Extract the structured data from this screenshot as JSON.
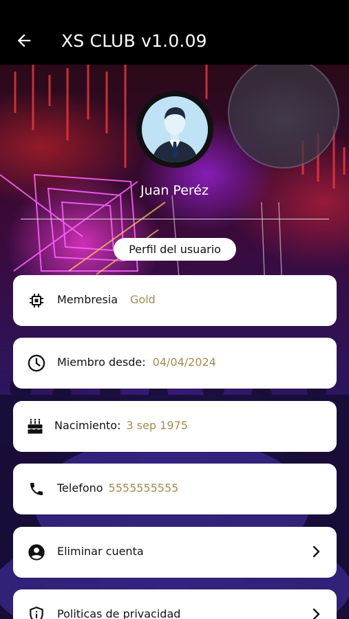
{
  "appbar": {
    "title": "XS CLUB v1.0.09",
    "back_icon": "arrow-back-icon"
  },
  "profile": {
    "name": "Juan Peréz",
    "avatar_icon": "user-avatar-icon"
  },
  "section": {
    "title": "Perfil del usuario"
  },
  "items": [
    {
      "icon": "chip-icon",
      "label": "Membresia",
      "value": "Gold"
    },
    {
      "icon": "clock-icon",
      "label": "Miembro desde:",
      "value": "04/04/2024"
    },
    {
      "icon": "cake-icon",
      "label": "Nacimiento:",
      "value": "3 sep 1975"
    },
    {
      "icon": "phone-icon",
      "label": "Telefono",
      "value": "5555555555"
    },
    {
      "icon": "account-circle-icon",
      "label": "Eliminar cuenta",
      "chevron": true
    },
    {
      "icon": "privacy-shield-icon",
      "label": "Politicas de privacidad",
      "chevron": true
    }
  ],
  "colors": {
    "accent_value": "#a58a52",
    "appbar_bg": "#000000",
    "card_bg": "#ffffff"
  }
}
